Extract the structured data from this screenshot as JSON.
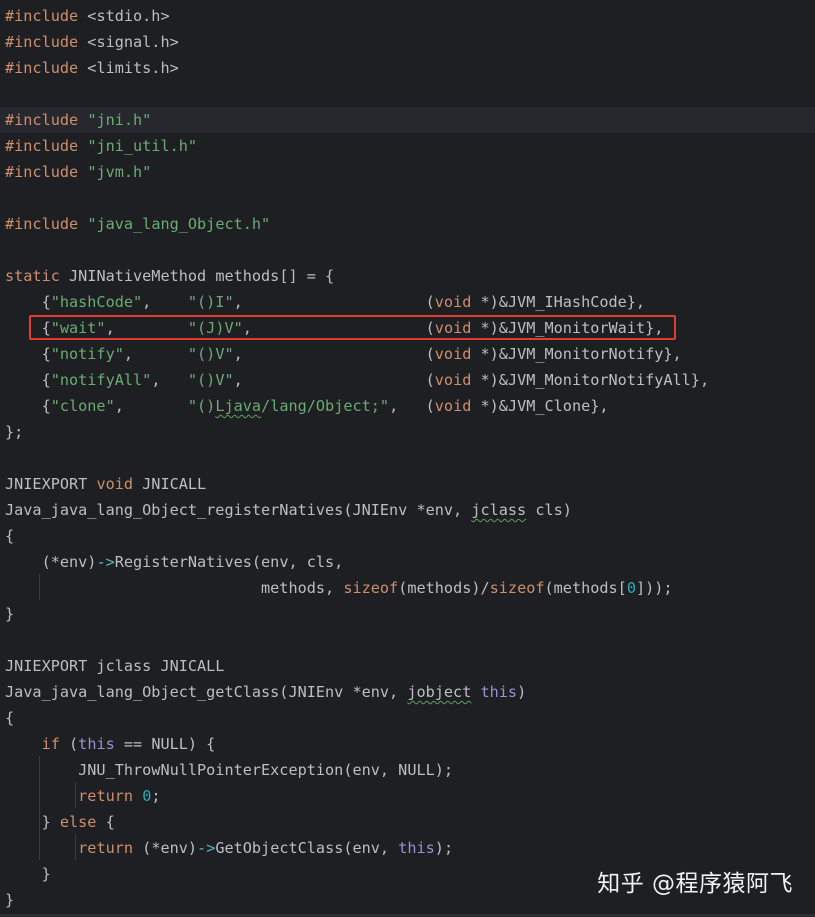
{
  "editor": {
    "language": "C",
    "theme_colors": {
      "background": "#1e1f22",
      "current_line": "#26282e",
      "keyword": "#cf8e6d",
      "string": "#6aab73",
      "number": "#2aacb8",
      "this_keyword": "#9c8fd3",
      "plain": "#bcbec4",
      "highlight_box": "#e03c31"
    },
    "highlighted_line": 12,
    "current_line": 4
  },
  "code": [
    [
      [
        "kw",
        "#include"
      ],
      [
        "p",
        " <stdio.h>"
      ]
    ],
    [
      [
        "kw",
        "#include"
      ],
      [
        "p",
        " <signal.h>"
      ]
    ],
    [
      [
        "kw",
        "#include"
      ],
      [
        "p",
        " <limits.h>"
      ]
    ],
    [],
    [
      [
        "kw",
        "#include"
      ],
      [
        "p",
        " "
      ],
      [
        "s",
        "\"jni.h\""
      ]
    ],
    [
      [
        "kw",
        "#include"
      ],
      [
        "p",
        " "
      ],
      [
        "s",
        "\"jni_util.h\""
      ]
    ],
    [
      [
        "kw",
        "#include"
      ],
      [
        "p",
        " "
      ],
      [
        "s",
        "\"jvm.h\""
      ]
    ],
    [],
    [
      [
        "kw",
        "#include"
      ],
      [
        "p",
        " "
      ],
      [
        "s",
        "\"java_lang_Object.h\""
      ]
    ],
    [],
    [
      [
        "kw",
        "static"
      ],
      [
        "p",
        " JNINativeMethod methods[] = {"
      ]
    ],
    [
      [
        "p",
        "    {"
      ],
      [
        "s",
        "\"hashCode\""
      ],
      [
        "p",
        ",    "
      ],
      [
        "s",
        "\"()I\""
      ],
      [
        "p",
        ",                    ("
      ],
      [
        "kw",
        "void"
      ],
      [
        "p",
        " *)&JVM_IHashCode},"
      ]
    ],
    [
      [
        "p",
        "    {"
      ],
      [
        "s",
        "\"wait\""
      ],
      [
        "p",
        ",        "
      ],
      [
        "s",
        "\"(J)V\""
      ],
      [
        "p",
        ",                   ("
      ],
      [
        "kw",
        "void"
      ],
      [
        "p",
        " *)&JVM_MonitorWait},"
      ]
    ],
    [
      [
        "p",
        "    {"
      ],
      [
        "s",
        "\"notify\""
      ],
      [
        "p",
        ",      "
      ],
      [
        "s",
        "\"()V\""
      ],
      [
        "p",
        ",                    ("
      ],
      [
        "kw",
        "void"
      ],
      [
        "p",
        " *)&JVM_MonitorNotify},"
      ]
    ],
    [
      [
        "p",
        "    {"
      ],
      [
        "s",
        "\"notifyAll\""
      ],
      [
        "p",
        ",   "
      ],
      [
        "s",
        "\"()V\""
      ],
      [
        "p",
        ",                    ("
      ],
      [
        "kw",
        "void"
      ],
      [
        "p",
        " *)&JVM_MonitorNotifyAll},"
      ]
    ],
    [
      [
        "p",
        "    {"
      ],
      [
        "s",
        "\"clone\""
      ],
      [
        "p",
        ",       "
      ],
      [
        "s",
        "\"()"
      ],
      [
        "sq",
        "Ljava"
      ],
      [
        "s",
        "/lang/Object;\""
      ],
      [
        "p",
        ",   ("
      ],
      [
        "kw",
        "void"
      ],
      [
        "p",
        " *)&JVM_Clone},"
      ]
    ],
    [
      [
        "p",
        "};"
      ]
    ],
    [],
    [
      [
        "p",
        "JNIEXPORT "
      ],
      [
        "kw",
        "void"
      ],
      [
        "p",
        " JNICALL"
      ]
    ],
    [
      [
        "p",
        "Java_java_lang_Object_registerNatives(JNIEnv *env, "
      ],
      [
        "psq",
        "jclass"
      ],
      [
        "p",
        " cls)"
      ]
    ],
    [
      [
        "p",
        "{"
      ]
    ],
    [
      [
        "p",
        "    (*env)"
      ],
      [
        "op",
        "->"
      ],
      [
        "p",
        "RegisterNatives(env, cls,"
      ]
    ],
    [
      [
        "p",
        "                            methods, "
      ],
      [
        "kw",
        "sizeof"
      ],
      [
        "p",
        "(methods)/"
      ],
      [
        "kw",
        "sizeof"
      ],
      [
        "p",
        "(methods["
      ],
      [
        "n",
        "0"
      ],
      [
        "p",
        "]));"
      ]
    ],
    [
      [
        "p",
        "}"
      ]
    ],
    [],
    [
      [
        "p",
        "JNIEXPORT jclass JNICALL"
      ]
    ],
    [
      [
        "p",
        "Java_java_lang_Object_getClass(JNIEnv *env, "
      ],
      [
        "psq",
        "jobject"
      ],
      [
        "p",
        " "
      ],
      [
        "t",
        "this"
      ],
      [
        "p",
        ")"
      ]
    ],
    [
      [
        "p",
        "{"
      ]
    ],
    [
      [
        "p",
        "    "
      ],
      [
        "kw",
        "if"
      ],
      [
        "p",
        " ("
      ],
      [
        "t",
        "this"
      ],
      [
        "p",
        " == NULL) {"
      ]
    ],
    [
      [
        "p",
        "        JNU_ThrowNullPointerException(env, NULL);"
      ]
    ],
    [
      [
        "p",
        "        "
      ],
      [
        "kw",
        "return"
      ],
      [
        "p",
        " "
      ],
      [
        "n",
        "0"
      ],
      [
        "p",
        ";"
      ]
    ],
    [
      [
        "p",
        "    } "
      ],
      [
        "kw",
        "else"
      ],
      [
        "p",
        " {"
      ]
    ],
    [
      [
        "p",
        "        "
      ],
      [
        "kw",
        "return"
      ],
      [
        "p",
        " (*env)"
      ],
      [
        "op",
        "->"
      ],
      [
        "p",
        "GetObjectClass(env, "
      ],
      [
        "t",
        "this"
      ],
      [
        "p",
        ");"
      ]
    ],
    [
      [
        "p",
        "    }"
      ]
    ],
    [
      [
        "p",
        "}"
      ]
    ]
  ],
  "watermark": {
    "text": "知乎 @程序猿阿飞"
  }
}
